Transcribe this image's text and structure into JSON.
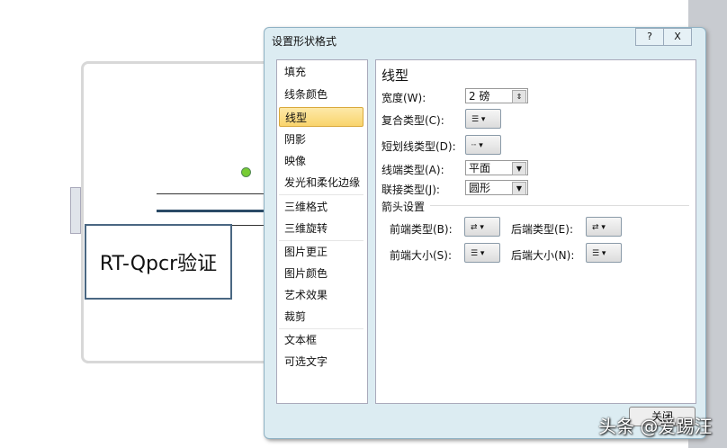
{
  "slide": {
    "shape_text": "RT-Qpcr验证"
  },
  "dialog": {
    "title": "设置形状格式",
    "help": "?",
    "close_x": "X",
    "categories": [
      "填充",
      "线条颜色",
      "线型",
      "阴影",
      "映像",
      "发光和柔化边缘",
      "三维格式",
      "三维旋转",
      "图片更正",
      "图片颜色",
      "艺术效果",
      "裁剪",
      "文本框",
      "可选文字"
    ],
    "selected_index": 2,
    "panel": {
      "heading": "线型",
      "width_label": "宽度(W):",
      "width_value": "2 磅",
      "compound_label": "复合类型(C):",
      "dash_label": "短划线类型(D):",
      "cap_label": "线端类型(A):",
      "cap_value": "平面",
      "join_label": "联接类型(J):",
      "join_value": "圆形",
      "arrow_section": "箭头设置",
      "begin_type": "前端类型(B):",
      "end_type": "后端类型(E):",
      "begin_size": "前端大小(S):",
      "end_size": "后端大小(N):"
    },
    "close_button": "关闭"
  },
  "watermark": "头条 @爱踢汪"
}
